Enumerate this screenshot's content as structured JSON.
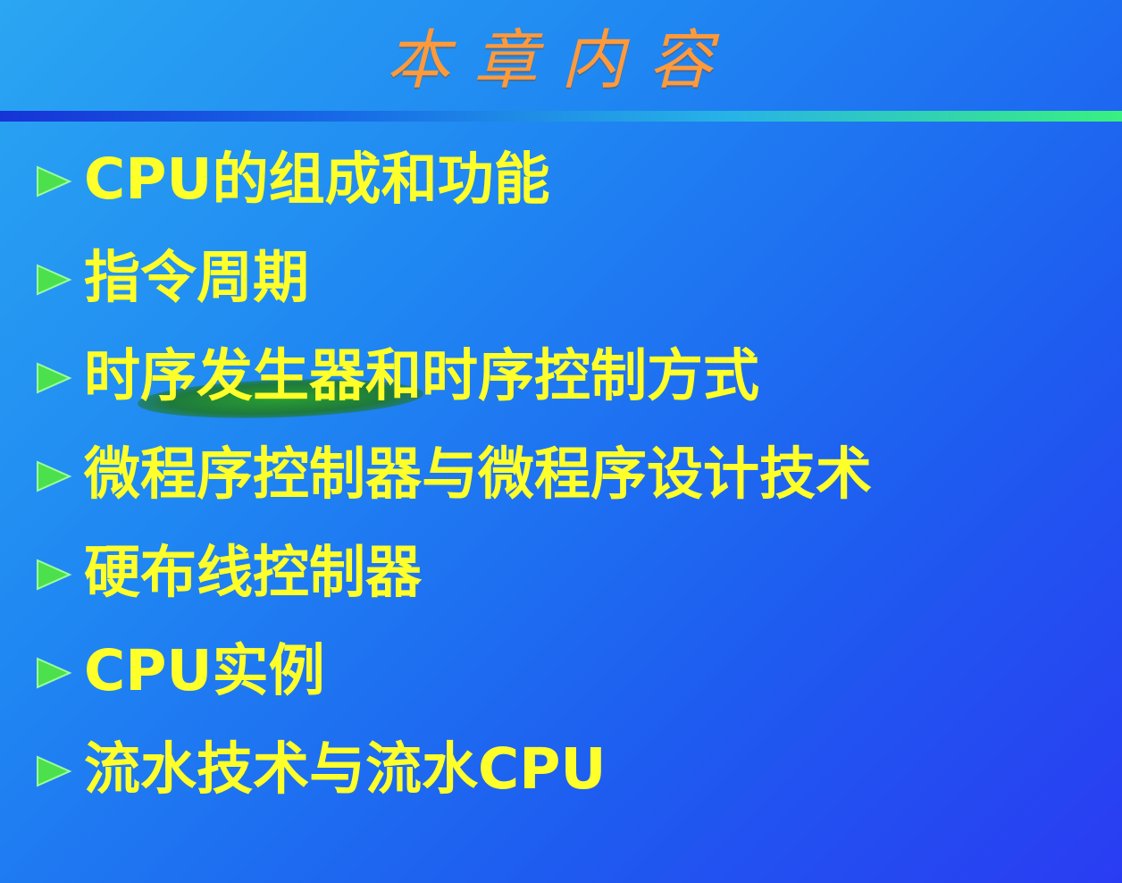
{
  "slide": {
    "title": "本章内容",
    "bullet_icon": "green-arrowhead-icon",
    "colors": {
      "title": "#ff9a3c",
      "item_text": "#ffff2a",
      "bullet": "#4de04d",
      "highlight": "#2aa028"
    },
    "items": [
      {
        "label": "CPU的组成和功能"
      },
      {
        "label": "指令周期"
      },
      {
        "label": "时序发生器和时序控制方式"
      },
      {
        "label": "微程序控制器与微程序设计技术"
      },
      {
        "label": "硬布线控制器"
      },
      {
        "label": "CPU实例"
      },
      {
        "label": "流水技术与流水CPU"
      }
    ]
  }
}
